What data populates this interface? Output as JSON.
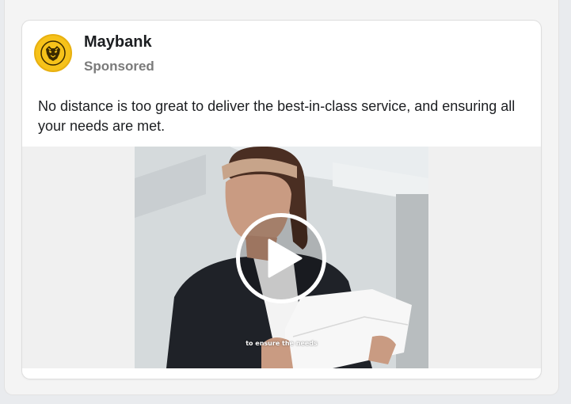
{
  "ad": {
    "advertiser": "Maybank",
    "label": "Sponsored",
    "caption": "No distance is too great to deliver the best-in-class service, and ensuring all your needs are met.",
    "video": {
      "subtitle": "to ensure the needs",
      "control_icon": "play-icon"
    },
    "logo_icon": "tiger-logo-icon"
  },
  "colors": {
    "brand_yellow": "#f6c21a",
    "text_primary": "#1c1e21",
    "text_secondary": "#7a7a7a",
    "card_background": "#ffffff",
    "media_background": "#f0f0f0"
  }
}
